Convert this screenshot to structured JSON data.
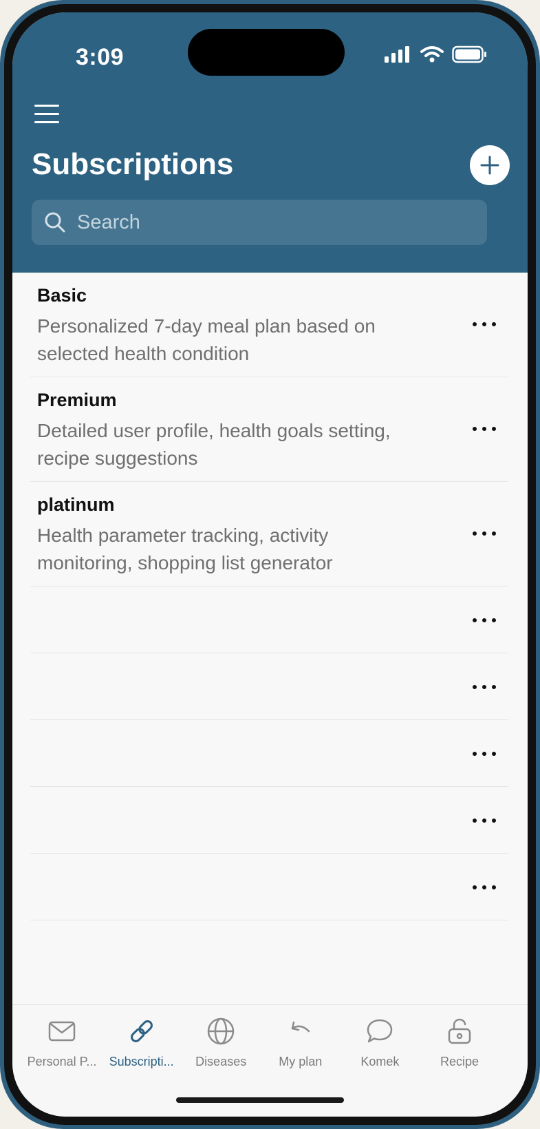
{
  "status": {
    "time": "3:09"
  },
  "header": {
    "title": "Subscriptions"
  },
  "search": {
    "placeholder": "Search"
  },
  "subscriptions": [
    {
      "title": "Basic",
      "description": "Personalized 7-day meal plan based on selected health condition"
    },
    {
      "title": "Premium",
      "description": "Detailed user profile, health goals setting, recipe suggestions"
    },
    {
      "title": "platinum",
      "description": "Health parameter tracking, activity monitoring, shopping list generator"
    }
  ],
  "empty_rows": 5,
  "tabs": [
    {
      "label": "Personal P...",
      "icon": "mail-icon"
    },
    {
      "label": "Subscripti...",
      "icon": "link-icon",
      "active": true
    },
    {
      "label": "Diseases",
      "icon": "globe-icon"
    },
    {
      "label": "My plan",
      "icon": "undo-arrow-icon"
    },
    {
      "label": "Komek",
      "icon": "chat-bubble-icon"
    },
    {
      "label": "Recipe",
      "icon": "unlock-icon"
    }
  ],
  "colors": {
    "header_bg": "#2d6282",
    "active_tab": "#2d6282",
    "inactive_tab": "#7a7a7a"
  }
}
